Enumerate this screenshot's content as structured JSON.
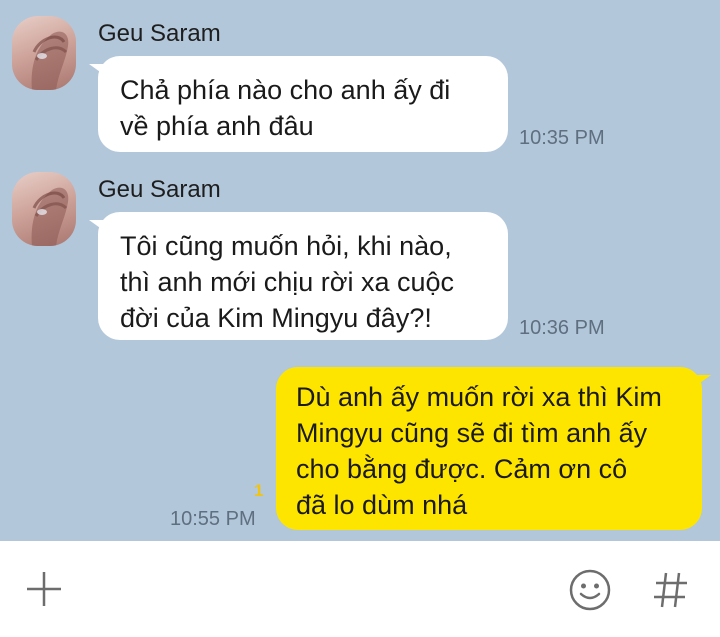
{
  "messages": [
    {
      "sender": "Geu Saram",
      "text": "Chả phía nào cho anh ấy đi\nvề phía anh đâu",
      "time": "10:35 PM",
      "direction": "incoming"
    },
    {
      "sender": "Geu Saram",
      "text": "Tôi cũng muốn hỏi, khi nào,\nthì anh mới chịu rời xa cuộc\nđời của Kim Mingyu đây?!",
      "time": "10:36 PM",
      "direction": "incoming"
    },
    {
      "text": "Dù anh ấy muốn rời xa thì Kim\nMingyu cũng sẽ đi tìm anh ấy\ncho bằng được. Cảm ơn cô\nđã lo dùm nhá",
      "time": "10:55 PM",
      "unread_count": "1",
      "direction": "outgoing"
    }
  ],
  "input_bar": {
    "add_icon": "plus-icon",
    "emoji_icon": "smiley-icon",
    "hashtag_icon": "hash-icon"
  },
  "colors": {
    "chat_background": "#b2c7da",
    "incoming_bubble": "#ffffff",
    "outgoing_bubble": "#fee500",
    "unread_badge": "#f1c40f"
  }
}
